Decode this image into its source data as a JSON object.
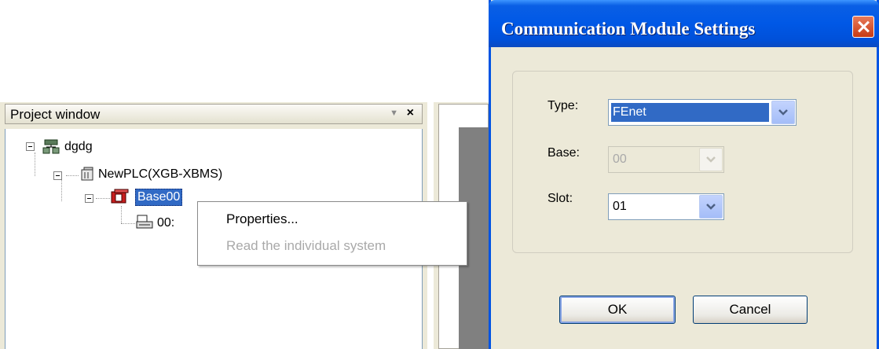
{
  "project_window": {
    "title": "Project window",
    "pin_glyph": "▼",
    "close_glyph": "×",
    "tree": {
      "project": {
        "label": "dgdg",
        "icon": "project-icon"
      },
      "plc": {
        "label": "NewPLC(XGB-XBMS)",
        "icon": "plc-icon"
      },
      "base": {
        "label": "Base00",
        "icon": "base-icon"
      },
      "module": {
        "label": "00:",
        "icon": "module-icon"
      }
    }
  },
  "context_menu": {
    "items": [
      {
        "label": "Properties...",
        "enabled": true
      },
      {
        "label": "Read the individual system",
        "enabled": false
      }
    ]
  },
  "dialog": {
    "title": "Communication Module Settings",
    "type": {
      "label": "Type:",
      "value": "FEnet"
    },
    "base": {
      "label": "Base:",
      "value": "00",
      "enabled": false
    },
    "slot": {
      "label": "Slot:",
      "value": "01"
    },
    "ok_label": "OK",
    "cancel_label": "Cancel"
  },
  "colors": {
    "titlebar": "#0058e6",
    "selection": "#316ac5",
    "close_button": "#c63a14",
    "dialog_bg": "#ece9d8"
  }
}
